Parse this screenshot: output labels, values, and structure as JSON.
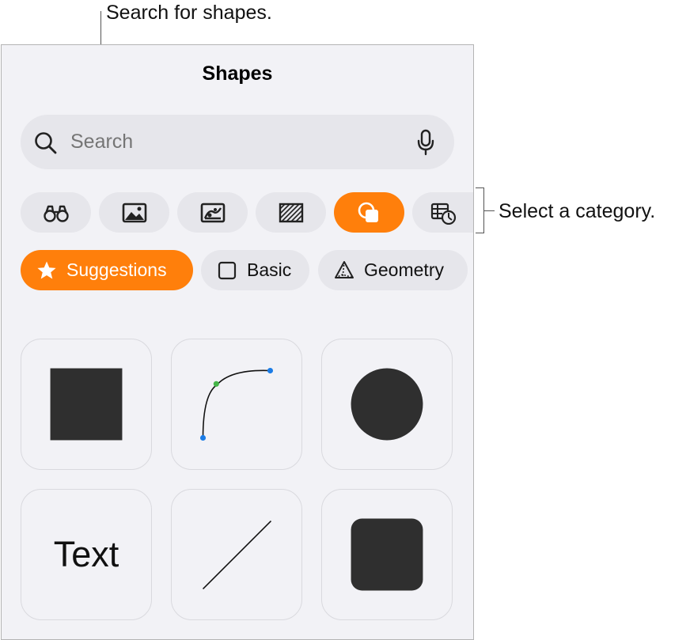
{
  "callouts": {
    "search": "Search for shapes.",
    "category": "Select a category."
  },
  "panel": {
    "title": "Shapes",
    "search": {
      "placeholder": "Search",
      "left_icon": "magnifying-glass-icon",
      "right_icon": "microphone-icon"
    },
    "categories": [
      {
        "icon": "binoculars-icon",
        "active": false
      },
      {
        "icon": "photo-icon",
        "active": false
      },
      {
        "icon": "media-icon",
        "active": false
      },
      {
        "icon": "hatched-pattern-icon",
        "active": false
      },
      {
        "icon": "shapes-icon",
        "active": true
      },
      {
        "icon": "table-chart-icon",
        "active": false
      }
    ],
    "subcategories": [
      {
        "label": "Suggestions",
        "icon": "star-icon",
        "active": true
      },
      {
        "label": "Basic",
        "icon": "square-outline-icon",
        "active": false
      },
      {
        "label": "Geometry",
        "icon": "pyramid-icon",
        "active": false
      }
    ],
    "tiles": [
      {
        "name": "square"
      },
      {
        "name": "curve"
      },
      {
        "name": "circle"
      },
      {
        "name": "text",
        "label": "Text"
      },
      {
        "name": "line"
      },
      {
        "name": "rounded-square"
      }
    ]
  },
  "colors": {
    "accent": "#ff7f0b",
    "panel_bg": "#f2f2f6",
    "control_bg": "#e6e6eb",
    "shape_fill": "#2f2f2f",
    "curve_point_green": "#45b649",
    "curve_point_blue": "#1b7ce6"
  }
}
